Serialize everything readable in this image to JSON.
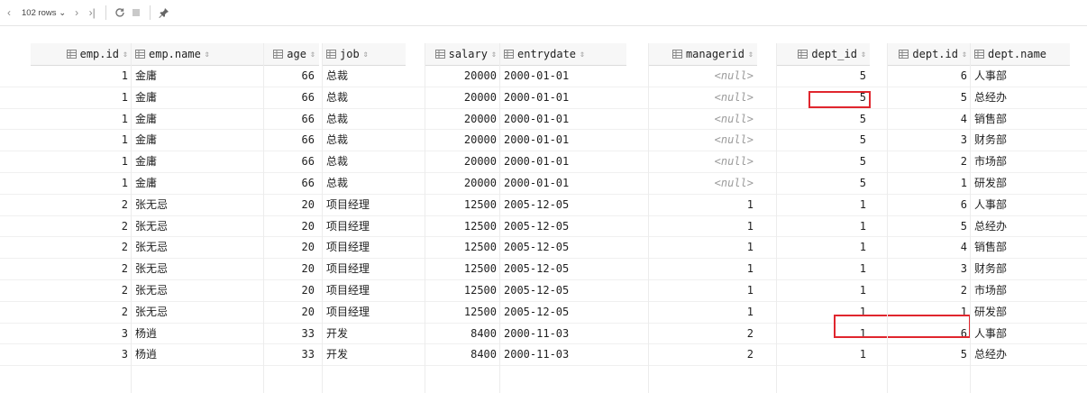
{
  "toolbar": {
    "rows_label": "102 rows",
    "icons": [
      "chevron-left-icon",
      "chevron-right-icon",
      "skip-last-icon",
      "refresh-icon",
      "stop-icon",
      "pin-icon"
    ]
  },
  "columns": [
    {
      "key": "emp_id",
      "label": "emp.id"
    },
    {
      "key": "emp_name",
      "label": "emp.name"
    },
    {
      "key": "age",
      "label": "age"
    },
    {
      "key": "job",
      "label": "job"
    },
    {
      "key": "salary",
      "label": "salary"
    },
    {
      "key": "entrydate",
      "label": "entrydate"
    },
    {
      "key": "managerid",
      "label": "managerid"
    },
    {
      "key": "dept_id",
      "label": "dept_id"
    },
    {
      "key": "dept_dot_id",
      "label": "dept.id"
    },
    {
      "key": "dept_name",
      "label": "dept.name"
    }
  ],
  "rows": [
    {
      "emp_id": "1",
      "emp_name": "金庸",
      "age": "66",
      "job": "总裁",
      "salary": "20000",
      "entrydate": "2000-01-01",
      "managerid": "<null>",
      "dept_id": "5",
      "dept_dot_id": "6",
      "dept_name": "人事部"
    },
    {
      "emp_id": "1",
      "emp_name": "金庸",
      "age": "66",
      "job": "总裁",
      "salary": "20000",
      "entrydate": "2000-01-01",
      "managerid": "<null>",
      "dept_id": "5",
      "dept_dot_id": "5",
      "dept_name": "总经办"
    },
    {
      "emp_id": "1",
      "emp_name": "金庸",
      "age": "66",
      "job": "总裁",
      "salary": "20000",
      "entrydate": "2000-01-01",
      "managerid": "<null>",
      "dept_id": "5",
      "dept_dot_id": "4",
      "dept_name": "销售部"
    },
    {
      "emp_id": "1",
      "emp_name": "金庸",
      "age": "66",
      "job": "总裁",
      "salary": "20000",
      "entrydate": "2000-01-01",
      "managerid": "<null>",
      "dept_id": "5",
      "dept_dot_id": "3",
      "dept_name": "财务部"
    },
    {
      "emp_id": "1",
      "emp_name": "金庸",
      "age": "66",
      "job": "总裁",
      "salary": "20000",
      "entrydate": "2000-01-01",
      "managerid": "<null>",
      "dept_id": "5",
      "dept_dot_id": "2",
      "dept_name": "市场部"
    },
    {
      "emp_id": "1",
      "emp_name": "金庸",
      "age": "66",
      "job": "总裁",
      "salary": "20000",
      "entrydate": "2000-01-01",
      "managerid": "<null>",
      "dept_id": "5",
      "dept_dot_id": "1",
      "dept_name": "研发部"
    },
    {
      "emp_id": "2",
      "emp_name": "张无忌",
      "age": "20",
      "job": "项目经理",
      "salary": "12500",
      "entrydate": "2005-12-05",
      "managerid": "1",
      "dept_id": "1",
      "dept_dot_id": "6",
      "dept_name": "人事部"
    },
    {
      "emp_id": "2",
      "emp_name": "张无忌",
      "age": "20",
      "job": "项目经理",
      "salary": "12500",
      "entrydate": "2005-12-05",
      "managerid": "1",
      "dept_id": "1",
      "dept_dot_id": "5",
      "dept_name": "总经办"
    },
    {
      "emp_id": "2",
      "emp_name": "张无忌",
      "age": "20",
      "job": "项目经理",
      "salary": "12500",
      "entrydate": "2005-12-05",
      "managerid": "1",
      "dept_id": "1",
      "dept_dot_id": "4",
      "dept_name": "销售部"
    },
    {
      "emp_id": "2",
      "emp_name": "张无忌",
      "age": "20",
      "job": "项目经理",
      "salary": "12500",
      "entrydate": "2005-12-05",
      "managerid": "1",
      "dept_id": "1",
      "dept_dot_id": "3",
      "dept_name": "财务部"
    },
    {
      "emp_id": "2",
      "emp_name": "张无忌",
      "age": "20",
      "job": "项目经理",
      "salary": "12500",
      "entrydate": "2005-12-05",
      "managerid": "1",
      "dept_id": "1",
      "dept_dot_id": "2",
      "dept_name": "市场部"
    },
    {
      "emp_id": "2",
      "emp_name": "张无忌",
      "age": "20",
      "job": "项目经理",
      "salary": "12500",
      "entrydate": "2005-12-05",
      "managerid": "1",
      "dept_id": "1",
      "dept_dot_id": "1",
      "dept_name": "研发部"
    },
    {
      "emp_id": "3",
      "emp_name": "杨逍",
      "age": "33",
      "job": "开发",
      "salary": "8400",
      "entrydate": "2000-11-03",
      "managerid": "2",
      "dept_id": "1",
      "dept_dot_id": "6",
      "dept_name": "人事部"
    },
    {
      "emp_id": "3",
      "emp_name": "杨逍",
      "age": "33",
      "job": "开发",
      "salary": "8400",
      "entrydate": "2000-11-03",
      "managerid": "2",
      "dept_id": "1",
      "dept_dot_id": "5",
      "dept_name": "总经办"
    }
  ],
  "highlight_color": "#e0262e"
}
